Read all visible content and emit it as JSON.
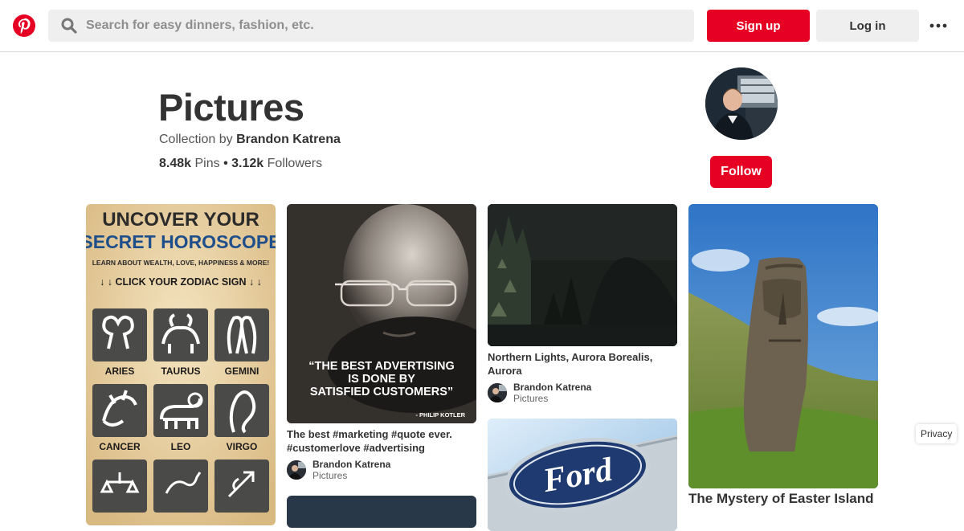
{
  "header": {
    "search_placeholder": "Search for easy dinners, fashion, etc.",
    "signup_label": "Sign up",
    "login_label": "Log in",
    "logo_icon": "pinterest-logo",
    "brand_color": "#e60023"
  },
  "board": {
    "title": "Pictures",
    "collection_prefix": "Collection by",
    "owner": "Brandon Katrena",
    "pins_count": "8.48k",
    "pins_label": "Pins",
    "separator": "•",
    "followers_count": "3.12k",
    "followers_label": "Followers",
    "follow_label": "Follow"
  },
  "pins": [
    {
      "id": "horoscope",
      "image_text": {
        "line1": "UNCOVER YOUR",
        "line2": "SECRET HOROSCOPE",
        "line3": "LEARN ABOUT WEALTH, LOVE, HAPPINESS & MORE!",
        "line4": "↓ ↓ CLICK YOUR ZODIAC SIGN ↓ ↓",
        "signs": [
          "ARIES",
          "TAURUS",
          "GEMINI",
          "CANCER",
          "LEO",
          "VIRGO"
        ]
      }
    },
    {
      "id": "marketing-quote",
      "image_text": {
        "quote_l1": "“THE BEST ADVERTISING",
        "quote_l2": "IS DONE BY",
        "quote_l3": "SATISFIED CUSTOMERS”",
        "attribution": "- PHILIP KOTLER"
      },
      "title": "The best #marketing #quote ever. #customerlove #advertising",
      "user": "Brandon Katrena",
      "board": "Pictures"
    },
    {
      "id": "northern-lights",
      "title": "Northern Lights, Aurora Borealis, Aurora",
      "user": "Brandon Katrena",
      "board": "Pictures"
    },
    {
      "id": "ford",
      "image_text": {
        "logo": "Ford"
      }
    },
    {
      "id": "easter-island",
      "title": "The Mystery of Easter Island"
    }
  ],
  "footer": {
    "privacy_label": "Privacy"
  }
}
